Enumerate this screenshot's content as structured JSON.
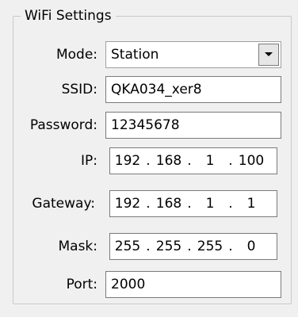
{
  "group": {
    "title": "WiFi Settings"
  },
  "fields": {
    "mode": {
      "label": "Mode:",
      "value": "Station"
    },
    "ssid": {
      "label": "SSID:",
      "value": "QKA034_xer8"
    },
    "password": {
      "label": "Password:",
      "value": "12345678"
    },
    "ip": {
      "label": "IP:",
      "octets": [
        "192",
        "168",
        "1",
        "100"
      ]
    },
    "gateway": {
      "label": "Gateway:",
      "octets": [
        "192",
        "168",
        "1",
        "1"
      ]
    },
    "mask": {
      "label": "Mask:",
      "octets": [
        "255",
        "255",
        "255",
        "0"
      ]
    },
    "port": {
      "label": "Port:",
      "value": "2000"
    }
  },
  "icons": {
    "dropdown": "chevron-down-icon"
  },
  "colors": {
    "panel_bg": "#f0f0f0",
    "field_bg": "#ffffff",
    "border": "#7a7a7a",
    "group_border": "#c9c9c9"
  }
}
